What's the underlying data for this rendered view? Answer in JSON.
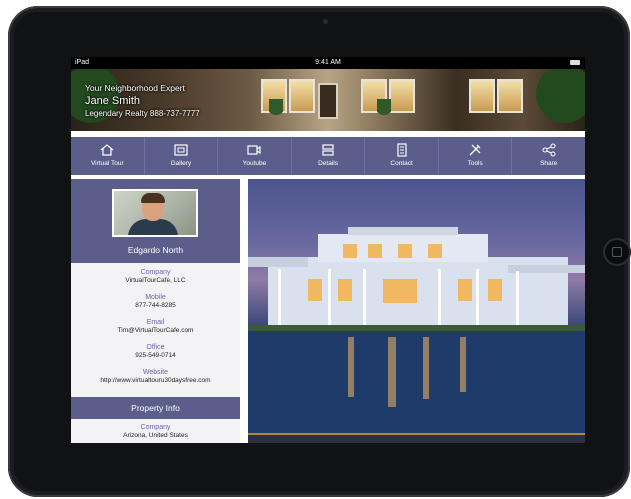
{
  "device": {
    "status_left": "iPad",
    "time": "9:41 AM"
  },
  "header": {
    "tagline": "Your Neighborhood Expert",
    "agent_name": "Jane Smith",
    "agency_line": "Legendary Realty 888-737-7777"
  },
  "nav": {
    "items": [
      {
        "label": "Virtual Tour",
        "icon": "home-icon"
      },
      {
        "label": "Gallery",
        "icon": "gallery-icon"
      },
      {
        "label": "Youtube",
        "icon": "video-icon"
      },
      {
        "label": "Details",
        "icon": "details-icon"
      },
      {
        "label": "Contact",
        "icon": "contact-icon"
      },
      {
        "label": "Tools",
        "icon": "tools-icon"
      },
      {
        "label": "Share",
        "icon": "share-icon"
      }
    ]
  },
  "profile": {
    "name": "Edgardo North",
    "fields": [
      {
        "label": "Company",
        "value": "VirtualTourCafe, LLC"
      },
      {
        "label": "Mobile",
        "value": "877-744-8285"
      },
      {
        "label": "Email",
        "value": "Tim@VirtualTourCafe.com"
      },
      {
        "label": "Office",
        "value": "925-549-0714"
      },
      {
        "label": "Website",
        "value": "http://www.virtualtouru30daysfree.com"
      }
    ]
  },
  "property": {
    "header": "Property Info",
    "label": "Company",
    "value": "Arizona, United States"
  },
  "colors": {
    "accent": "#5b5e8a",
    "label_purple": "#6c63a8",
    "device": "#111214"
  }
}
